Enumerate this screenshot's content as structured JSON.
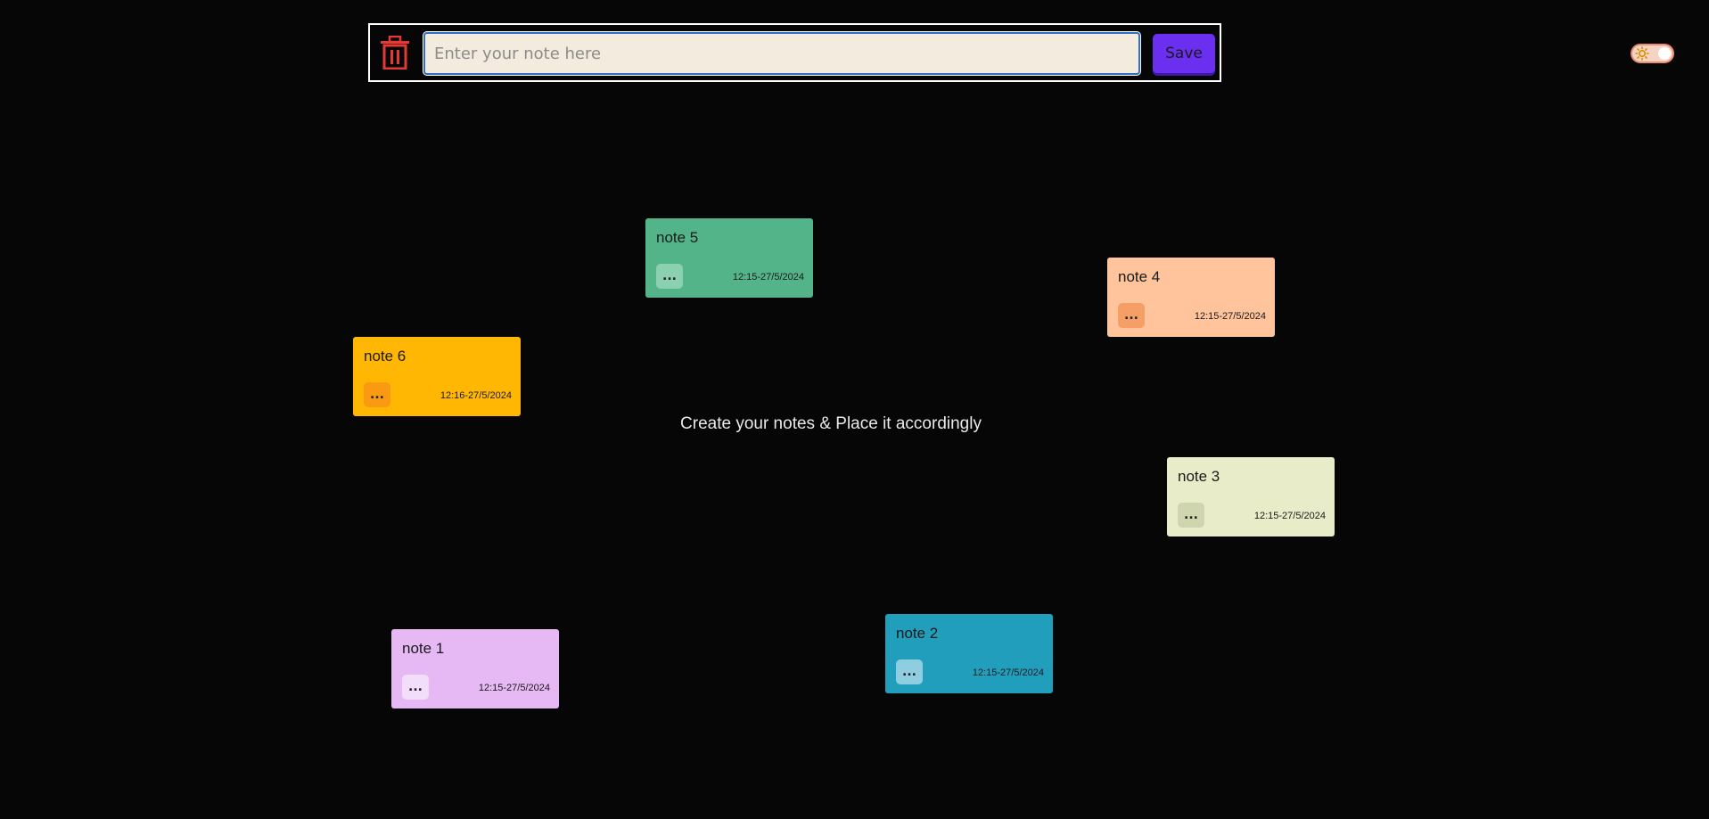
{
  "editor": {
    "input_placeholder": "Enter your note here",
    "input_value": "",
    "save_label": "Save",
    "trash_icon": "trash-icon",
    "trash_color": "#e53935"
  },
  "theme_toggle": {
    "icon": "sun-icon",
    "state": "light"
  },
  "hint": "Create your notes & Place it accordingly",
  "notes": [
    {
      "title": "note 5",
      "time": "12:15-27/5/2024",
      "menu": "...",
      "color": "#53b48a",
      "button_color": "#8bd0b0"
    },
    {
      "title": "note 4",
      "time": "12:15-27/5/2024",
      "menu": "...",
      "color": "#ffc49c",
      "button_color": "#f59f66"
    },
    {
      "title": "note 6",
      "time": "12:16-27/5/2024",
      "menu": "...",
      "color": "#ffb703",
      "button_color": "#fa9a12"
    },
    {
      "title": "note 3",
      "time": "12:15-27/5/2024",
      "menu": "...",
      "color": "#e8ecc8",
      "button_color": "#cfd5ae"
    },
    {
      "title": "note 2",
      "time": "12:15-27/5/2024",
      "menu": "...",
      "color": "#219ebc",
      "button_color": "#8fcde0"
    },
    {
      "title": "note 1",
      "time": "12:15-27/5/2024",
      "menu": "...",
      "color": "#e6b8f4",
      "button_color": "#f2ddfb"
    }
  ]
}
